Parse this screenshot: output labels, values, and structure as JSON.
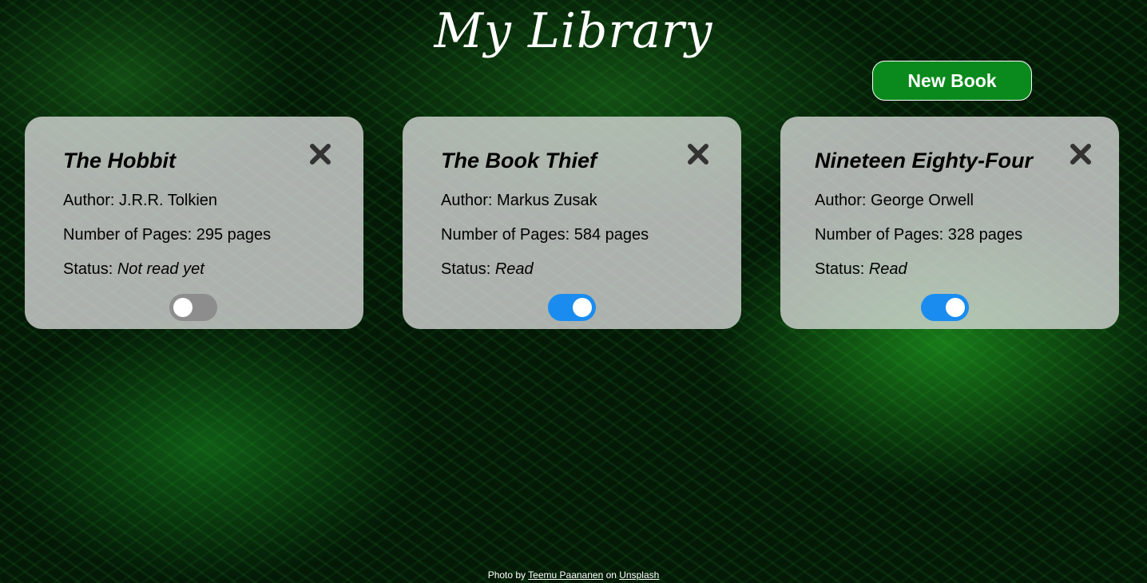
{
  "header": {
    "title": "My Library",
    "new_book_label": "New Book"
  },
  "books": [
    {
      "title": "The Hobbit",
      "author_line": "Author: J.R.R. Tolkien",
      "pages_line": "Number of Pages: 295 pages",
      "status_label": "Status: ",
      "status_value": "Not read yet",
      "read": false
    },
    {
      "title": "The Book Thief",
      "author_line": "Author: Markus Zusak",
      "pages_line": "Number of Pages: 584 pages",
      "status_label": "Status: ",
      "status_value": "Read",
      "read": true
    },
    {
      "title": "Nineteen Eighty-Four",
      "author_line": "Author: George Orwell",
      "pages_line": "Number of Pages: 328 pages",
      "status_label": "Status: ",
      "status_value": "Read",
      "read": true
    }
  ],
  "footer": {
    "prefix": "Photo by ",
    "photographer": "Teemu Paananen",
    "middle": " on ",
    "site": "Unsplash"
  },
  "colors": {
    "button_bg": "#0a8a1c",
    "toggle_on": "#1a8cf0",
    "toggle_off": "#8d8d8d",
    "card_bg": "rgba(220,220,220,0.78)"
  },
  "icons": {
    "close": "close-icon"
  }
}
